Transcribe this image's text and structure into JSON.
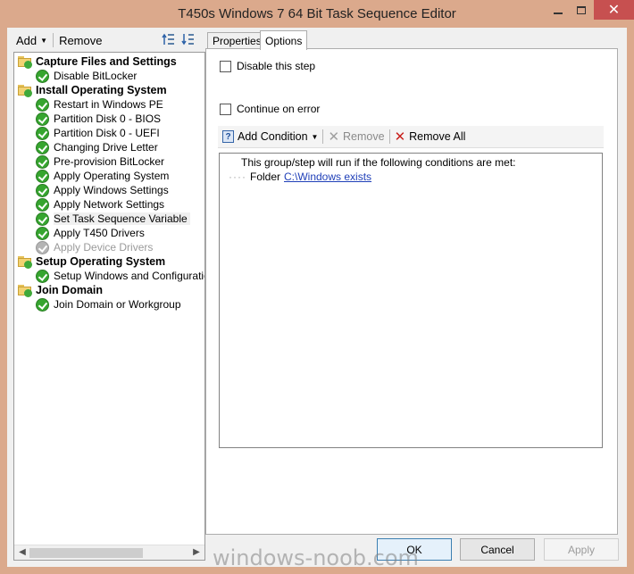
{
  "window": {
    "title": "T450s Windows 7 64 Bit Task Sequence Editor",
    "close_glyph": "✕"
  },
  "left_toolbar": {
    "add_label": "Add",
    "remove_label": "Remove"
  },
  "tree": {
    "groups": [
      {
        "label": "Capture Files and Settings",
        "items": [
          {
            "label": "Disable BitLocker",
            "enabled": true
          }
        ]
      },
      {
        "label": "Install Operating System",
        "items": [
          {
            "label": "Restart in Windows PE",
            "enabled": true
          },
          {
            "label": "Partition Disk 0 - BIOS",
            "enabled": true
          },
          {
            "label": "Partition Disk 0 - UEFI",
            "enabled": true
          },
          {
            "label": "Changing Drive Letter",
            "enabled": true
          },
          {
            "label": "Pre-provision BitLocker",
            "enabled": true
          },
          {
            "label": "Apply Operating System",
            "enabled": true
          },
          {
            "label": "Apply Windows Settings",
            "enabled": true
          },
          {
            "label": "Apply Network Settings",
            "enabled": true
          },
          {
            "label": "Set Task Sequence Variable",
            "enabled": true,
            "selected": true
          },
          {
            "label": "Apply T450 Drivers",
            "enabled": true
          },
          {
            "label": "Apply Device Drivers",
            "enabled": false
          }
        ]
      },
      {
        "label": "Setup Operating System",
        "items": [
          {
            "label": "Setup Windows and Configuration",
            "enabled": true
          }
        ]
      },
      {
        "label": "Join Domain",
        "items": [
          {
            "label": "Join Domain or Workgroup",
            "enabled": true
          }
        ]
      }
    ]
  },
  "tabs": {
    "properties": "Properties",
    "options": "Options"
  },
  "options": {
    "disable_step_label": "Disable this step",
    "continue_on_error_label": "Continue on error",
    "add_condition_label": "Add Condition",
    "remove_label": "Remove",
    "remove_all_label": "Remove All",
    "condition_header": "This group/step will run if the following conditions are met:",
    "condition_prefix": "Folder",
    "condition_link": "C:\\Windows exists"
  },
  "buttons": {
    "ok": "OK",
    "cancel": "Cancel",
    "apply": "Apply"
  },
  "watermark": "windows-noob.com",
  "colors": {
    "frame": "#dba98c",
    "close": "#c75050",
    "check_green": "#36a52f",
    "link": "#1f3fb8",
    "remove_all_red": "#c8201c"
  }
}
